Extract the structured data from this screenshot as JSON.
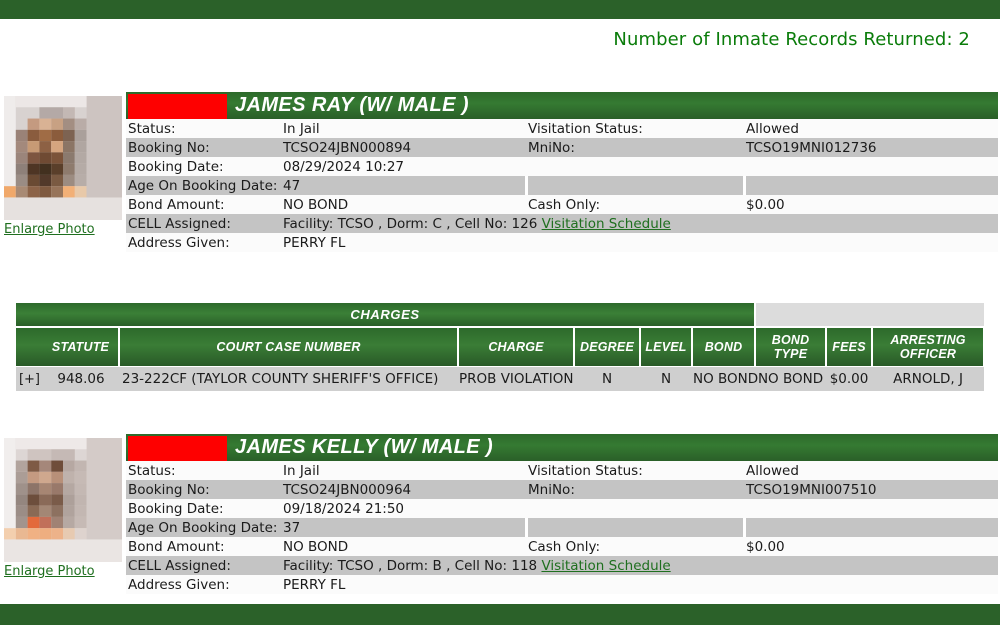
{
  "header": {
    "records_returned": "Number of Inmate Records Returned: 2",
    "accent_green": "#2b6129",
    "bright_green": "#0a7c0a",
    "redaction_color": "#fe0000"
  },
  "labels": {
    "status": "Status:",
    "booking_no": "Booking No:",
    "booking_date": "Booking Date:",
    "age_on_booking": "Age On Booking Date:",
    "bond_amount": "Bond Amount:",
    "cell_assigned": "CELL Assigned:",
    "address_given": "Address Given:",
    "visitation_status": "Visitation Status:",
    "mni_no": "MniNo:",
    "cash_only": "Cash Only:",
    "visitation_schedule": "Visitation Schedule",
    "enlarge_photo": "Enlarge Photo"
  },
  "records": [
    {
      "name": "JAMES RAY   (W/ MALE )",
      "status": "In Jail",
      "booking_no": "TCSO24JBN000894",
      "booking_date": "08/29/2024 10:27",
      "age_on_booking": "47",
      "bond_amount": "NO BOND",
      "cell_assigned": "Facility: TCSO , Dorm: C , Cell No: 126",
      "address_given": "PERRY FL",
      "visitation_status": "Allowed",
      "mni_no": "TCSO19MNI012736",
      "cash_only": "$0.00"
    },
    {
      "name": "JAMES KELLY   (W/ MALE )",
      "status": "In Jail",
      "booking_no": "TCSO24JBN000964",
      "booking_date": "09/18/2024 21:50",
      "age_on_booking": "37",
      "bond_amount": "NO BOND",
      "cell_assigned": "Facility: TCSO , Dorm: B , Cell No: 118",
      "address_given": "PERRY FL",
      "visitation_status": "Allowed",
      "mni_no": "TCSO19MNI007510",
      "cash_only": "$0.00"
    }
  ],
  "charges_table": {
    "title": "CHARGES",
    "columns": [
      "",
      "STATUTE",
      "COURT CASE NUMBER",
      "CHARGE",
      "DEGREE",
      "LEVEL",
      "BOND",
      "BOND TYPE",
      "FEES",
      "ARRESTING OFFICER"
    ],
    "column_lines": [
      [
        "",
        ""
      ],
      [
        "STATUTE",
        ""
      ],
      [
        "COURT CASE NUMBER",
        ""
      ],
      [
        "CHARGE",
        ""
      ],
      [
        "DEGREE",
        ""
      ],
      [
        "LEVEL",
        ""
      ],
      [
        "BOND",
        ""
      ],
      [
        "BOND",
        "TYPE"
      ],
      [
        "FEES",
        ""
      ],
      [
        "ARRESTING",
        "OFFICER"
      ]
    ],
    "rows": [
      {
        "expand": "[+]",
        "statute": "948.06",
        "court_case_number": "23-222CF (TAYLOR COUNTY SHERIFF'S OFFICE)",
        "charge": "PROB VIOLATION",
        "degree": "N",
        "level": "N",
        "bond": "NO BOND",
        "bond_type": "NO BOND",
        "fees": "$0.00",
        "arresting_officer": "ARNOLD, J"
      }
    ]
  }
}
